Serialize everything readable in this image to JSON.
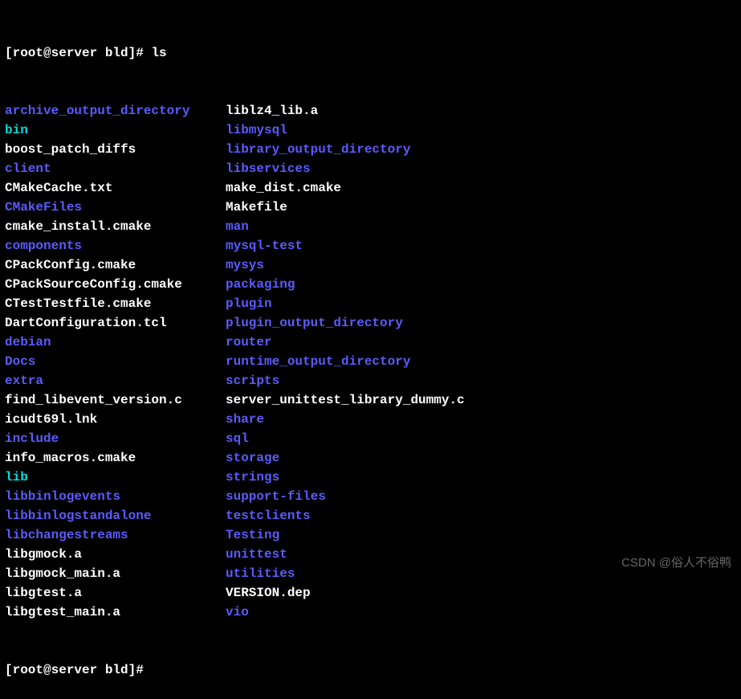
{
  "prompt1": "[root@server bld]# ",
  "cmd1": "ls",
  "prompt2": "[root@server bld]#",
  "listing": [
    {
      "c1": {
        "text": "archive_output_directory",
        "type": "dir"
      },
      "c2": {
        "text": "liblz4_lib.a",
        "type": "file"
      }
    },
    {
      "c1": {
        "text": "bin",
        "type": "symlink"
      },
      "c2": {
        "text": "libmysql",
        "type": "dir"
      }
    },
    {
      "c1": {
        "text": "boost_patch_diffs",
        "type": "file"
      },
      "c2": {
        "text": "library_output_directory",
        "type": "dir"
      }
    },
    {
      "c1": {
        "text": "client",
        "type": "dir"
      },
      "c2": {
        "text": "libservices",
        "type": "dir"
      }
    },
    {
      "c1": {
        "text": "CMakeCache.txt",
        "type": "file"
      },
      "c2": {
        "text": "make_dist.cmake",
        "type": "file"
      }
    },
    {
      "c1": {
        "text": "CMakeFiles",
        "type": "dir"
      },
      "c2": {
        "text": "Makefile",
        "type": "file"
      }
    },
    {
      "c1": {
        "text": "cmake_install.cmake",
        "type": "file"
      },
      "c2": {
        "text": "man",
        "type": "dir"
      }
    },
    {
      "c1": {
        "text": "components",
        "type": "dir"
      },
      "c2": {
        "text": "mysql-test",
        "type": "dir"
      }
    },
    {
      "c1": {
        "text": "CPackConfig.cmake",
        "type": "file"
      },
      "c2": {
        "text": "mysys",
        "type": "dir"
      }
    },
    {
      "c1": {
        "text": "CPackSourceConfig.cmake",
        "type": "file"
      },
      "c2": {
        "text": "packaging",
        "type": "dir"
      }
    },
    {
      "c1": {
        "text": "CTestTestfile.cmake",
        "type": "file"
      },
      "c2": {
        "text": "plugin",
        "type": "dir"
      }
    },
    {
      "c1": {
        "text": "DartConfiguration.tcl",
        "type": "file"
      },
      "c2": {
        "text": "plugin_output_directory",
        "type": "dir"
      }
    },
    {
      "c1": {
        "text": "debian",
        "type": "dir"
      },
      "c2": {
        "text": "router",
        "type": "dir"
      }
    },
    {
      "c1": {
        "text": "Docs",
        "type": "dir"
      },
      "c2": {
        "text": "runtime_output_directory",
        "type": "dir"
      }
    },
    {
      "c1": {
        "text": "extra",
        "type": "dir"
      },
      "c2": {
        "text": "scripts",
        "type": "dir"
      }
    },
    {
      "c1": {
        "text": "find_libevent_version.c",
        "type": "file"
      },
      "c2": {
        "text": "server_unittest_library_dummy.c",
        "type": "file"
      }
    },
    {
      "c1": {
        "text": "icudt69l.lnk",
        "type": "file"
      },
      "c2": {
        "text": "share",
        "type": "dir"
      }
    },
    {
      "c1": {
        "text": "include",
        "type": "dir"
      },
      "c2": {
        "text": "sql",
        "type": "dir"
      }
    },
    {
      "c1": {
        "text": "info_macros.cmake",
        "type": "file"
      },
      "c2": {
        "text": "storage",
        "type": "dir"
      }
    },
    {
      "c1": {
        "text": "lib",
        "type": "symlink"
      },
      "c2": {
        "text": "strings",
        "type": "dir"
      }
    },
    {
      "c1": {
        "text": "libbinlogevents",
        "type": "dir"
      },
      "c2": {
        "text": "support-files",
        "type": "dir"
      }
    },
    {
      "c1": {
        "text": "libbinlogstandalone",
        "type": "dir"
      },
      "c2": {
        "text": "testclients",
        "type": "dir"
      }
    },
    {
      "c1": {
        "text": "libchangestreams",
        "type": "dir"
      },
      "c2": {
        "text": "Testing",
        "type": "dir"
      }
    },
    {
      "c1": {
        "text": "libgmock.a",
        "type": "file"
      },
      "c2": {
        "text": "unittest",
        "type": "dir"
      }
    },
    {
      "c1": {
        "text": "libgmock_main.a",
        "type": "file"
      },
      "c2": {
        "text": "utilities",
        "type": "dir"
      }
    },
    {
      "c1": {
        "text": "libgtest.a",
        "type": "file"
      },
      "c2": {
        "text": "VERSION.dep",
        "type": "file"
      }
    },
    {
      "c1": {
        "text": "libgtest_main.a",
        "type": "file"
      },
      "c2": {
        "text": "vio",
        "type": "dir"
      }
    }
  ],
  "watermark": "CSDN @俗人不俗鸭"
}
